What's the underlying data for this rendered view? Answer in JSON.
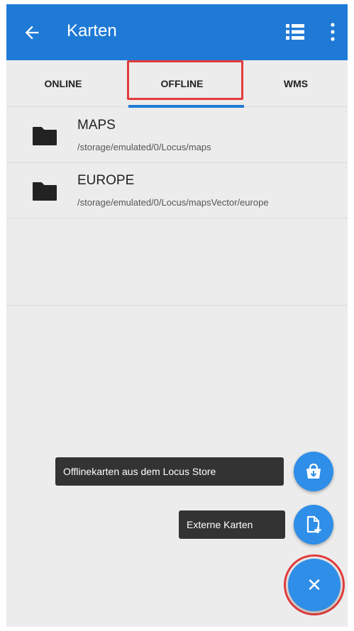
{
  "appbar": {
    "title": "Karten",
    "color": "#1f7ad6",
    "icons": [
      "back-arrow-icon",
      "list-view-icon",
      "more-vert-icon"
    ]
  },
  "tabs": [
    {
      "label": "ONLINE",
      "selected": false
    },
    {
      "label": "OFFLINE",
      "selected": true
    },
    {
      "label": "WMS",
      "selected": false
    }
  ],
  "folders": [
    {
      "name": "MAPS",
      "path": "/storage/emulated/0/Locus/maps",
      "icon": "folder-icon"
    },
    {
      "name": "EUROPE",
      "path": "/storage/emulated/0/Locus/mapsVector/europe",
      "icon": "folder-icon"
    }
  ],
  "speed_dial": {
    "store_label": "Offlinekarten aus dem Locus Store",
    "store_icon": "store-bag-icon",
    "extern_label": "Externe Karten",
    "extern_icon": "add-file-icon",
    "close_symbol": "✕",
    "fab_color": "#2e8ee8",
    "highlight_color": "#e23b3b"
  }
}
